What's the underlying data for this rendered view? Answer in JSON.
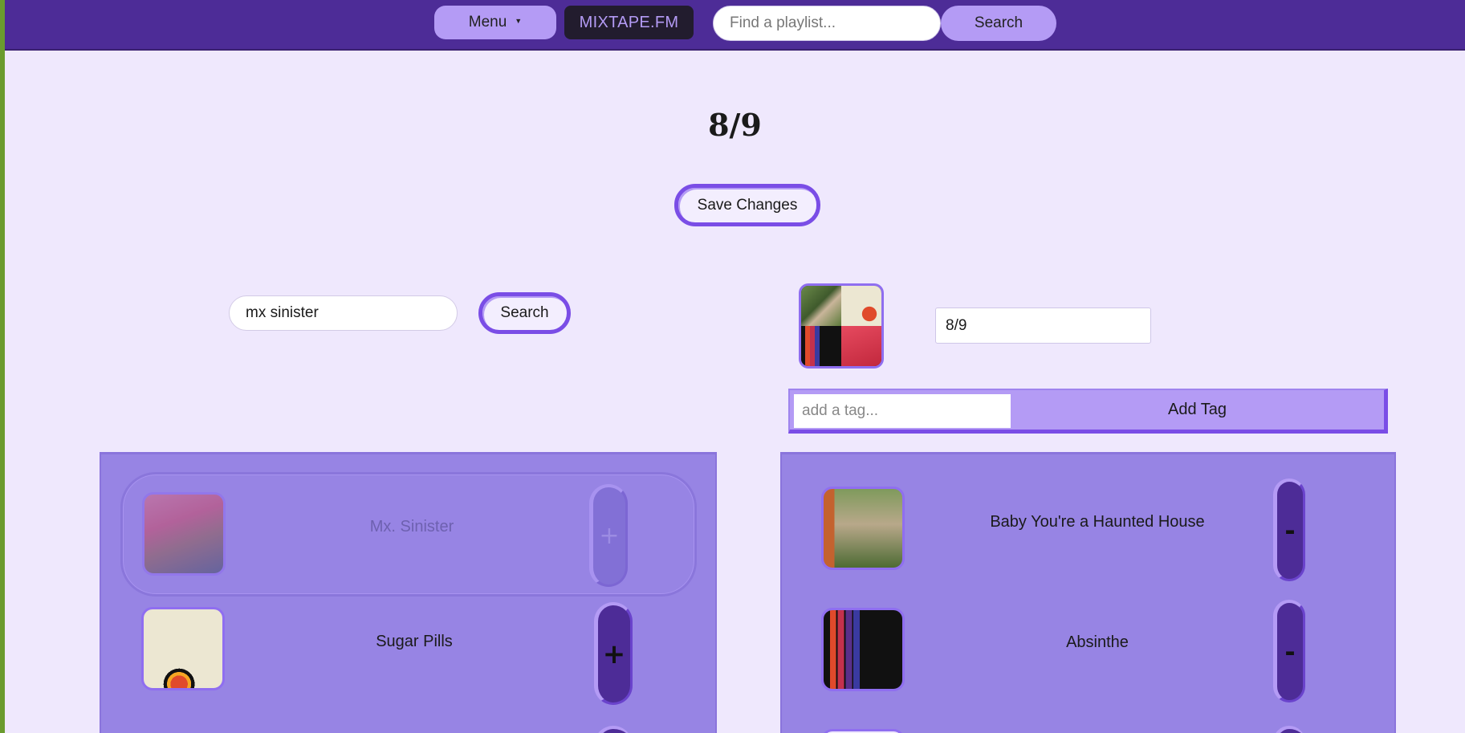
{
  "nav": {
    "menu_label": "Menu",
    "menu_caret": "▼",
    "brand": "MIXTAPE.FM",
    "search_placeholder": "Find a playlist...",
    "search_label": "Search"
  },
  "editor": {
    "title": "8/9",
    "save_label": "Save Changes"
  },
  "song_search": {
    "value": "mx sinister",
    "button_label": "Search"
  },
  "playlist": {
    "name_value": "8/9",
    "tag_placeholder": "add a tag...",
    "add_tag_label": "Add Tag"
  },
  "results": [
    {
      "title": "Mx. Sinister",
      "action": "+",
      "disabled": true
    },
    {
      "title": "Sugar Pills",
      "action": "+",
      "disabled": false
    }
  ],
  "tracks": [
    {
      "title": "Baby You're a Haunted House",
      "action": "-"
    },
    {
      "title": "Absinthe",
      "action": "-"
    }
  ],
  "colors": {
    "navbar": "#4d2c97",
    "accent": "#b49bf5",
    "accent_dark": "#7a4de6",
    "panel": "#9784e4",
    "background": "#efe8fd"
  }
}
